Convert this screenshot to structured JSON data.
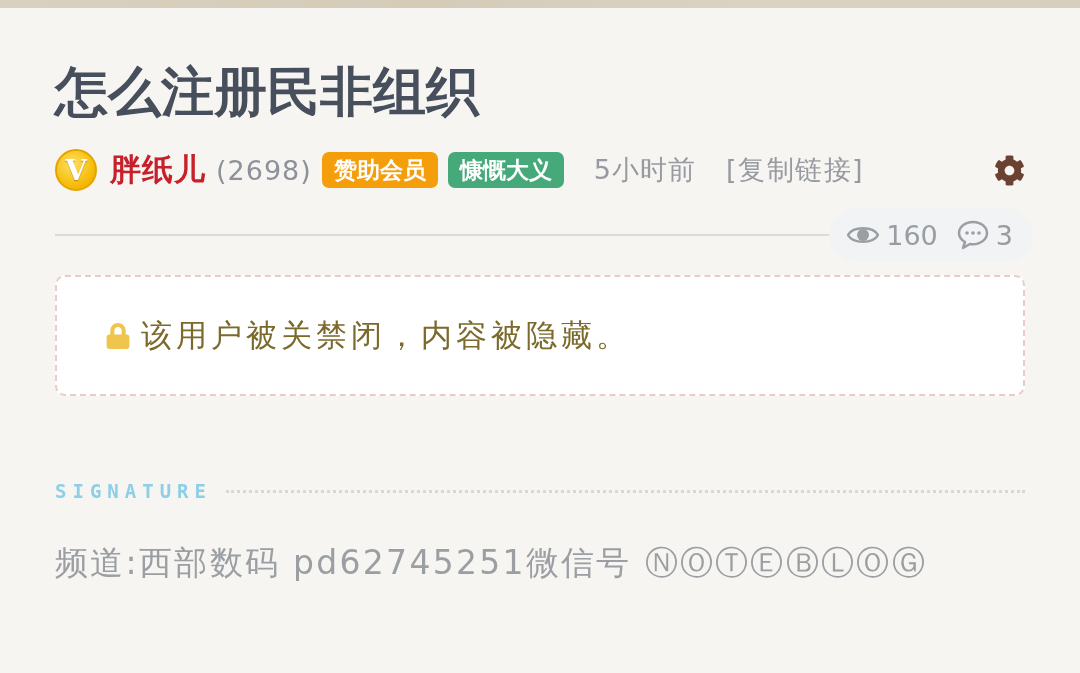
{
  "post": {
    "title": "怎么注册民非组织",
    "author": {
      "vip_mark": "V",
      "name": "胖纸儿",
      "points": "(2698)"
    },
    "badges": [
      {
        "label": "赞助会员",
        "color": "#f59e0b"
      },
      {
        "label": "慷慨大义",
        "color": "#46a97a"
      }
    ],
    "time": "5小时前",
    "copy_link": "[复制链接]",
    "stats": {
      "views": "160",
      "comments": "3"
    },
    "notice": "该用户被关禁闭，内容被隐藏。",
    "signature": {
      "label": "SIGNATURE",
      "text": "频道:西部数码 pd62745251微信号 ⓃⓄⓉⒺⒷⓁⓄⒼ"
    }
  }
}
